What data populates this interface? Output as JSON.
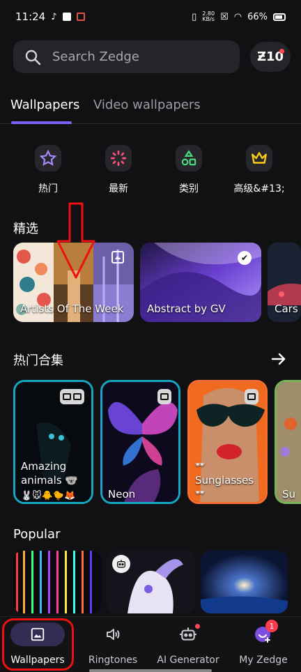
{
  "status": {
    "time": "11:24",
    "speed_top": "2.80",
    "speed_bottom": "KB/s",
    "battery": "66%"
  },
  "search": {
    "placeholder": "Search Zedge",
    "zcoins": "Ƶ10"
  },
  "tabs": [
    "Wallpapers",
    "Video wallpapers"
  ],
  "categories": [
    "热门",
    "最新",
    "类别",
    "高级&#13;"
  ],
  "sections": {
    "featured": "精选",
    "hot_collections": "热门合集",
    "popular": "Popular"
  },
  "featured_cards": [
    {
      "title": "Artists Of The Week"
    },
    {
      "title": "Abstract by GV"
    },
    {
      "title": "Cars"
    }
  ],
  "collection_cards": [
    {
      "title_line1": "Amazing",
      "title_line2": "animals 🐨",
      "emoji_line": "🐰🐭🐥🐤🦊"
    },
    {
      "title_line1": "Neon"
    },
    {
      "title_line1": "Sunglasses",
      "emoji_top": "🕶",
      "emoji_bottom": "🕶"
    },
    {
      "title_line1": "Su"
    }
  ],
  "bottom_nav": [
    {
      "label": "Wallpapers",
      "icon": "image-icon"
    },
    {
      "label": "Ringtones",
      "icon": "speaker-icon"
    },
    {
      "label": "AI Generator",
      "icon": "robot-icon"
    },
    {
      "label": "My Zedge",
      "icon": "profile-icon",
      "badge": "1"
    }
  ],
  "colors": {
    "accent": "#7b61ff",
    "background": "#111113",
    "highlight": "#e11111"
  }
}
